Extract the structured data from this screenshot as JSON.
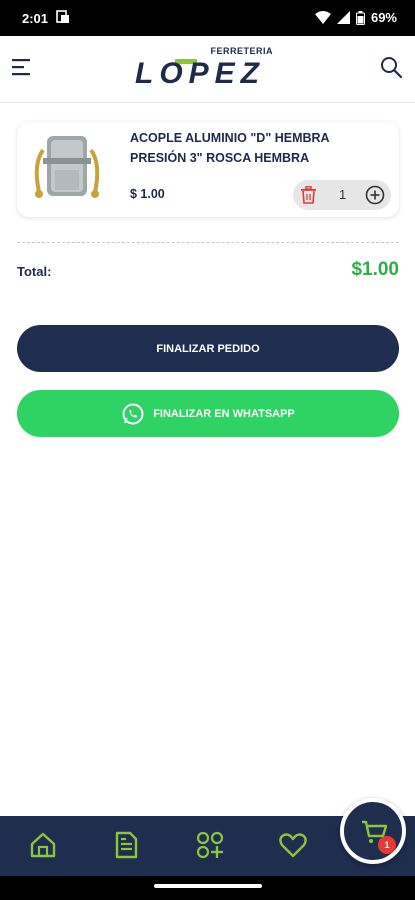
{
  "status_bar": {
    "time": "2:01",
    "battery": "69%"
  },
  "header": {
    "logo_top": "FERRETERIA",
    "logo_main": "LOPEZ"
  },
  "cart": {
    "items": [
      {
        "name": "ACOPLE ALUMINIO \"D\" HEMBRA PRESIÓN 3\" ROSCA HEMBRA",
        "price": "$ 1.00",
        "quantity": "1"
      }
    ],
    "total_label": "Total:",
    "total_value": "$1.00"
  },
  "buttons": {
    "finalize": "FINALIZAR PEDIDO",
    "whatsapp": "FINALIZAR EN WHATSAPP"
  },
  "bottom_nav": {
    "cart_count": "1"
  },
  "colors": {
    "navy": "#1f2d4f",
    "green_accent": "#8bc53f",
    "price_green": "#2eae44",
    "whatsapp_green": "#2ed364",
    "badge_red": "#e53935"
  }
}
